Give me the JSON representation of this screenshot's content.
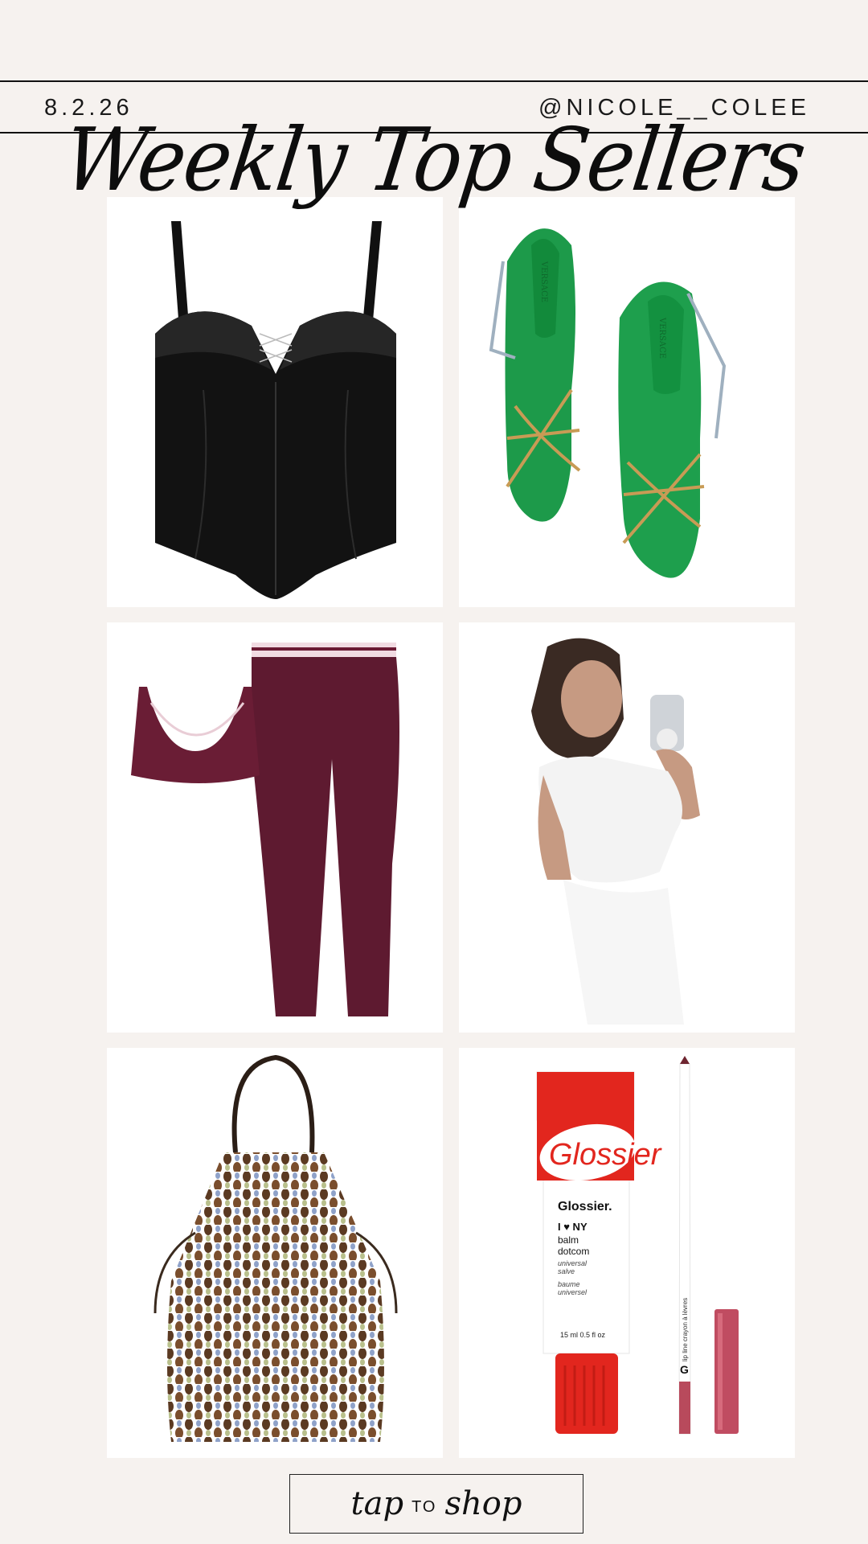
{
  "header": {
    "date": "8.2.26",
    "handle": "@NICOLE__COLEE",
    "title": "Weekly Top Sellers"
  },
  "products": [
    {
      "name": "black corset top"
    },
    {
      "name": "green strappy heels",
      "brand_mark": "VERSACE"
    },
    {
      "name": "burgundy sports bra and leggings set"
    },
    {
      "name": "white tee and sweatpants mirror selfie"
    },
    {
      "name": "beaded net tote bag"
    },
    {
      "name": "balm and lip liner",
      "tube_logo": "Glossier",
      "tube_brand": "Glossier.",
      "tube_line1": "I ♥ NY",
      "tube_line2": "balm",
      "tube_line3": "dotcom",
      "tube_line4": "universal",
      "tube_line5": "salve",
      "tube_line6": "baume",
      "tube_line7": "universel",
      "tube_size": "15 ml   0.5 fl oz",
      "pencil_text": "lip line   crayon à lèvres"
    }
  ],
  "cta": {
    "word1": "tap",
    "word2": "TO",
    "word3": "shop"
  },
  "colors": {
    "background": "#f6f2ef",
    "tile": "#ffffff",
    "ink": "#111111"
  }
}
